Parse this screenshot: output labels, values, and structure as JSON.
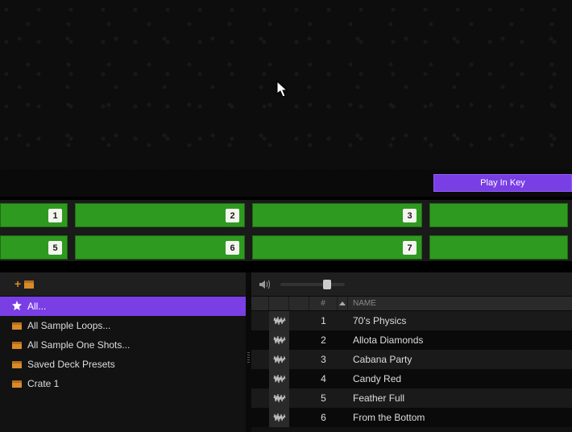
{
  "playkey_label": "Play In Key",
  "pads": {
    "row1": [
      "1",
      "2",
      "3",
      ""
    ],
    "row2": [
      "5",
      "6",
      "7",
      ""
    ]
  },
  "sidebar": {
    "items": [
      {
        "label": "All...",
        "icon": "star"
      },
      {
        "label": "All Sample Loops...",
        "icon": "crate"
      },
      {
        "label": "All Sample One Shots...",
        "icon": "crate"
      },
      {
        "label": "Saved Deck Presets",
        "icon": "crate"
      },
      {
        "label": "Crate 1",
        "icon": "crate"
      }
    ],
    "selected_index": 0
  },
  "volume": {
    "value": 0.75
  },
  "table": {
    "header_num": "#",
    "header_name": "NAME",
    "rows": [
      {
        "num": "1",
        "name": "70's Physics"
      },
      {
        "num": "2",
        "name": "Allota Diamonds"
      },
      {
        "num": "3",
        "name": "Cabana Party"
      },
      {
        "num": "4",
        "name": "Candy Red"
      },
      {
        "num": "5",
        "name": "Feather Full"
      },
      {
        "num": "6",
        "name": "From the Bottom"
      }
    ]
  }
}
